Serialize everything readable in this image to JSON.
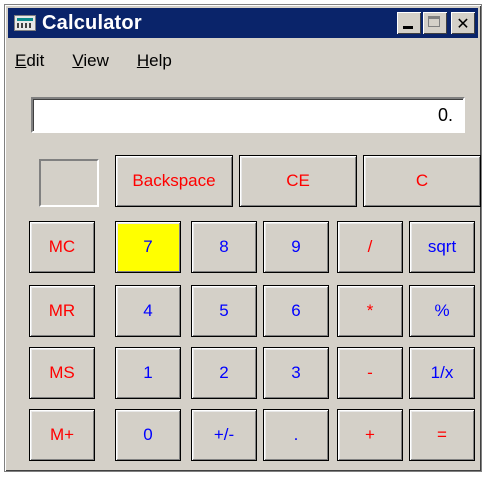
{
  "window": {
    "title": "Calculator"
  },
  "menu": {
    "items": [
      {
        "label": "Edit",
        "accel": "E",
        "rest": "dit"
      },
      {
        "label": "View",
        "accel": "V",
        "rest": "iew"
      },
      {
        "label": "Help",
        "accel": "H",
        "rest": "elp"
      }
    ]
  },
  "display": {
    "value": "0."
  },
  "buttons": {
    "backspace": "Backspace",
    "ce": "CE",
    "c": "C",
    "mc": "MC",
    "mr": "MR",
    "ms": "MS",
    "mplus": "M+",
    "d7": "7",
    "d8": "8",
    "d9": "9",
    "d4": "4",
    "d5": "5",
    "d6": "6",
    "d1": "1",
    "d2": "2",
    "d3": "3",
    "d0": "0",
    "sign": "+/-",
    "dot": ".",
    "div": "/",
    "mul": "*",
    "sub": "-",
    "add": "+",
    "sqrt": "sqrt",
    "pct": "%",
    "inv": "1/x",
    "eq": "="
  },
  "colors": {
    "titlebar": "#0a246a",
    "face": "#d4d0c8",
    "red_label": "#ff0000",
    "blue_label": "#0000ff",
    "highlight": "#ffff00"
  }
}
